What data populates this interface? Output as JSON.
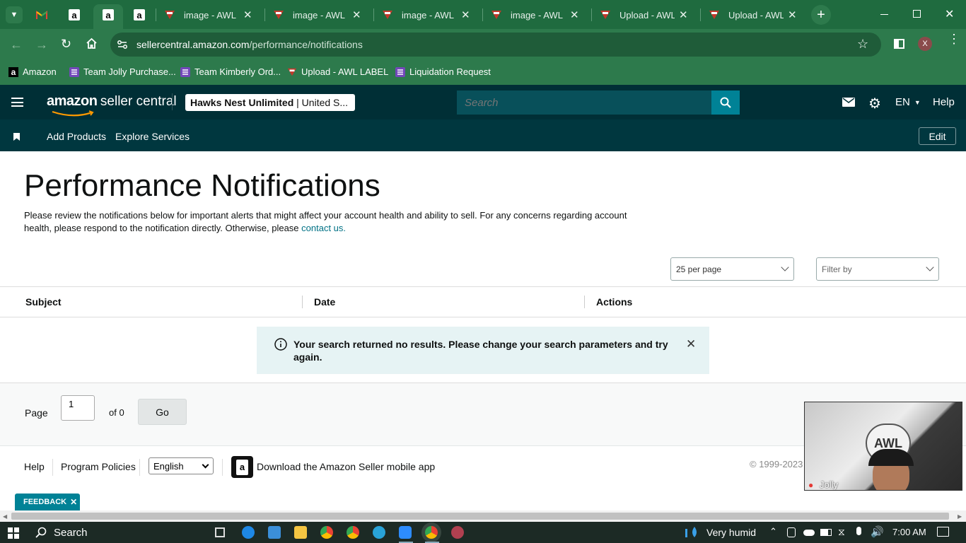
{
  "browser": {
    "tabs": [
      {
        "icon": "gmail-icon",
        "title": ""
      },
      {
        "icon": "amazon-icon",
        "title": ""
      },
      {
        "icon": "amazon-icon",
        "title": "",
        "active": true
      },
      {
        "icon": "amazon-icon",
        "title": ""
      },
      {
        "icon": "awl-icon",
        "title": "image - AWL LA"
      },
      {
        "icon": "awl-icon",
        "title": "image - AWL LA"
      },
      {
        "icon": "awl-icon",
        "title": "image - AWL LA"
      },
      {
        "icon": "awl-icon",
        "title": "image - AWL LA"
      },
      {
        "icon": "awl-icon",
        "title": "Upload - AWL L"
      },
      {
        "icon": "awl-icon",
        "title": "Upload - AWL L"
      }
    ],
    "url_host": "sellercentral.amazon.com",
    "url_path": "/performance/notifications",
    "profile_initial": "X",
    "bookmarks": [
      {
        "label": "Amazon"
      },
      {
        "label": "Team Jolly Purchase..."
      },
      {
        "label": "Team Kimberly Ord..."
      },
      {
        "label": "Upload - AWL LABEL"
      },
      {
        "label": "Liquidation Request"
      }
    ]
  },
  "header": {
    "logo_brand": "amazon",
    "logo_suffix": "seller central",
    "store_name": "Hawks Nest Unlimited",
    "store_region": "| United S...",
    "search_placeholder": "Search",
    "language": "EN",
    "help": "Help"
  },
  "nav": {
    "items": [
      "Add Products",
      "Explore Services"
    ],
    "edit": "Edit"
  },
  "page": {
    "title": "Performance Notifications",
    "intro": "Please review the notifications below for important alerts that might affect your account health and ability to sell. For any concerns regarding account health, please respond to the notification directly. Otherwise, please ",
    "contact_link": "contact us.",
    "per_page": "25 per page",
    "filter": "Filter by",
    "columns": [
      "Subject",
      "Date",
      "Actions"
    ],
    "no_results": "Your search returned no results. Please change your search parameters and try again.",
    "page_label": "Page",
    "page_value": "1",
    "page_of": "of 0",
    "go": "Go"
  },
  "footer": {
    "help": "Help",
    "policies": "Program Policies",
    "language": "English",
    "app_text": "Download the Amazon Seller mobile app",
    "copyright": "© 1999-2023"
  },
  "feedback": "FEEDBACK",
  "video": {
    "name": "Jolly"
  },
  "taskbar": {
    "search": "Search",
    "weather": "Very humid",
    "time": "7:00 AM"
  },
  "colors": {
    "chrome_tab": "#1f6b3f",
    "chrome_bar": "#2d7a4c",
    "amazon_header": "#002f36",
    "amazon_nav": "#00373f",
    "search_button": "#008296",
    "link": "#007185",
    "alert_bg": "#e6f3f4",
    "feedback": "#008296"
  }
}
